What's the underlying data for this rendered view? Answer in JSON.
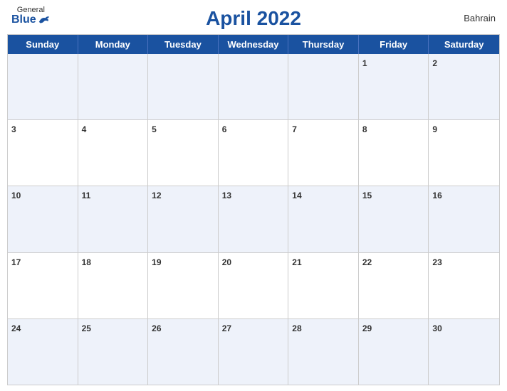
{
  "header": {
    "title": "April 2022",
    "country": "Bahrain",
    "logo": {
      "general": "General",
      "blue": "Blue"
    }
  },
  "dayHeaders": [
    "Sunday",
    "Monday",
    "Tuesday",
    "Wednesday",
    "Thursday",
    "Friday",
    "Saturday"
  ],
  "weeks": [
    [
      {
        "num": "",
        "empty": true
      },
      {
        "num": "",
        "empty": true
      },
      {
        "num": "",
        "empty": true
      },
      {
        "num": "",
        "empty": true
      },
      {
        "num": "",
        "empty": true
      },
      {
        "num": "1",
        "empty": false
      },
      {
        "num": "2",
        "empty": false
      }
    ],
    [
      {
        "num": "3",
        "empty": false
      },
      {
        "num": "4",
        "empty": false
      },
      {
        "num": "5",
        "empty": false
      },
      {
        "num": "6",
        "empty": false
      },
      {
        "num": "7",
        "empty": false
      },
      {
        "num": "8",
        "empty": false
      },
      {
        "num": "9",
        "empty": false
      }
    ],
    [
      {
        "num": "10",
        "empty": false
      },
      {
        "num": "11",
        "empty": false
      },
      {
        "num": "12",
        "empty": false
      },
      {
        "num": "13",
        "empty": false
      },
      {
        "num": "14",
        "empty": false
      },
      {
        "num": "15",
        "empty": false
      },
      {
        "num": "16",
        "empty": false
      }
    ],
    [
      {
        "num": "17",
        "empty": false
      },
      {
        "num": "18",
        "empty": false
      },
      {
        "num": "19",
        "empty": false
      },
      {
        "num": "20",
        "empty": false
      },
      {
        "num": "21",
        "empty": false
      },
      {
        "num": "22",
        "empty": false
      },
      {
        "num": "23",
        "empty": false
      }
    ],
    [
      {
        "num": "24",
        "empty": false
      },
      {
        "num": "25",
        "empty": false
      },
      {
        "num": "26",
        "empty": false
      },
      {
        "num": "27",
        "empty": false
      },
      {
        "num": "28",
        "empty": false
      },
      {
        "num": "29",
        "empty": false
      },
      {
        "num": "30",
        "empty": false
      }
    ]
  ]
}
